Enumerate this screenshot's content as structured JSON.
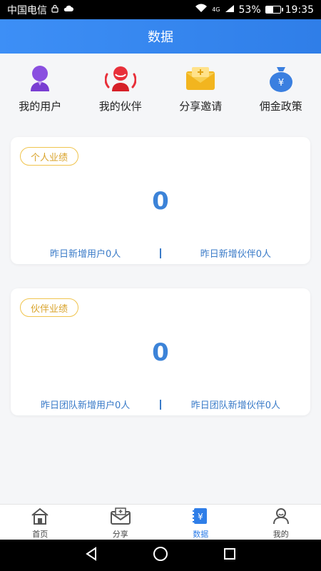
{
  "status_bar": {
    "carrier": "中国电信",
    "network": "4G",
    "battery": "53%",
    "time": "19:35",
    "battery_level": 0.53
  },
  "header": {
    "title": "数据"
  },
  "quick_links": [
    {
      "label": "我的用户",
      "icon": "user-icon",
      "color": "#8a4fe0"
    },
    {
      "label": "我的伙伴",
      "icon": "partners-icon",
      "color": "#e8303a"
    },
    {
      "label": "分享邀请",
      "icon": "envelope-icon",
      "color": "#f2b51f"
    },
    {
      "label": "佣金政策",
      "icon": "money-bag-icon",
      "color": "#3a7fe0"
    }
  ],
  "cards": [
    {
      "tag": "个人业绩",
      "value": "0",
      "stat_left": "昨日新增用户0人",
      "stat_right": "昨日新增伙伴0人"
    },
    {
      "tag": "伙伴业绩",
      "value": "0",
      "stat_left": "昨日团队新增用户0人",
      "stat_right": "昨日团队新增伙伴0人"
    }
  ],
  "bottom_nav": [
    {
      "label": "首页",
      "icon": "home-icon",
      "active": false
    },
    {
      "label": "分享",
      "icon": "share-icon",
      "active": false
    },
    {
      "label": "数据",
      "icon": "data-icon",
      "active": true
    },
    {
      "label": "我的",
      "icon": "profile-icon",
      "active": false
    }
  ],
  "colors": {
    "primary": "#2f7ee8",
    "tag": "#f0c44e",
    "value": "#3c83d8"
  }
}
